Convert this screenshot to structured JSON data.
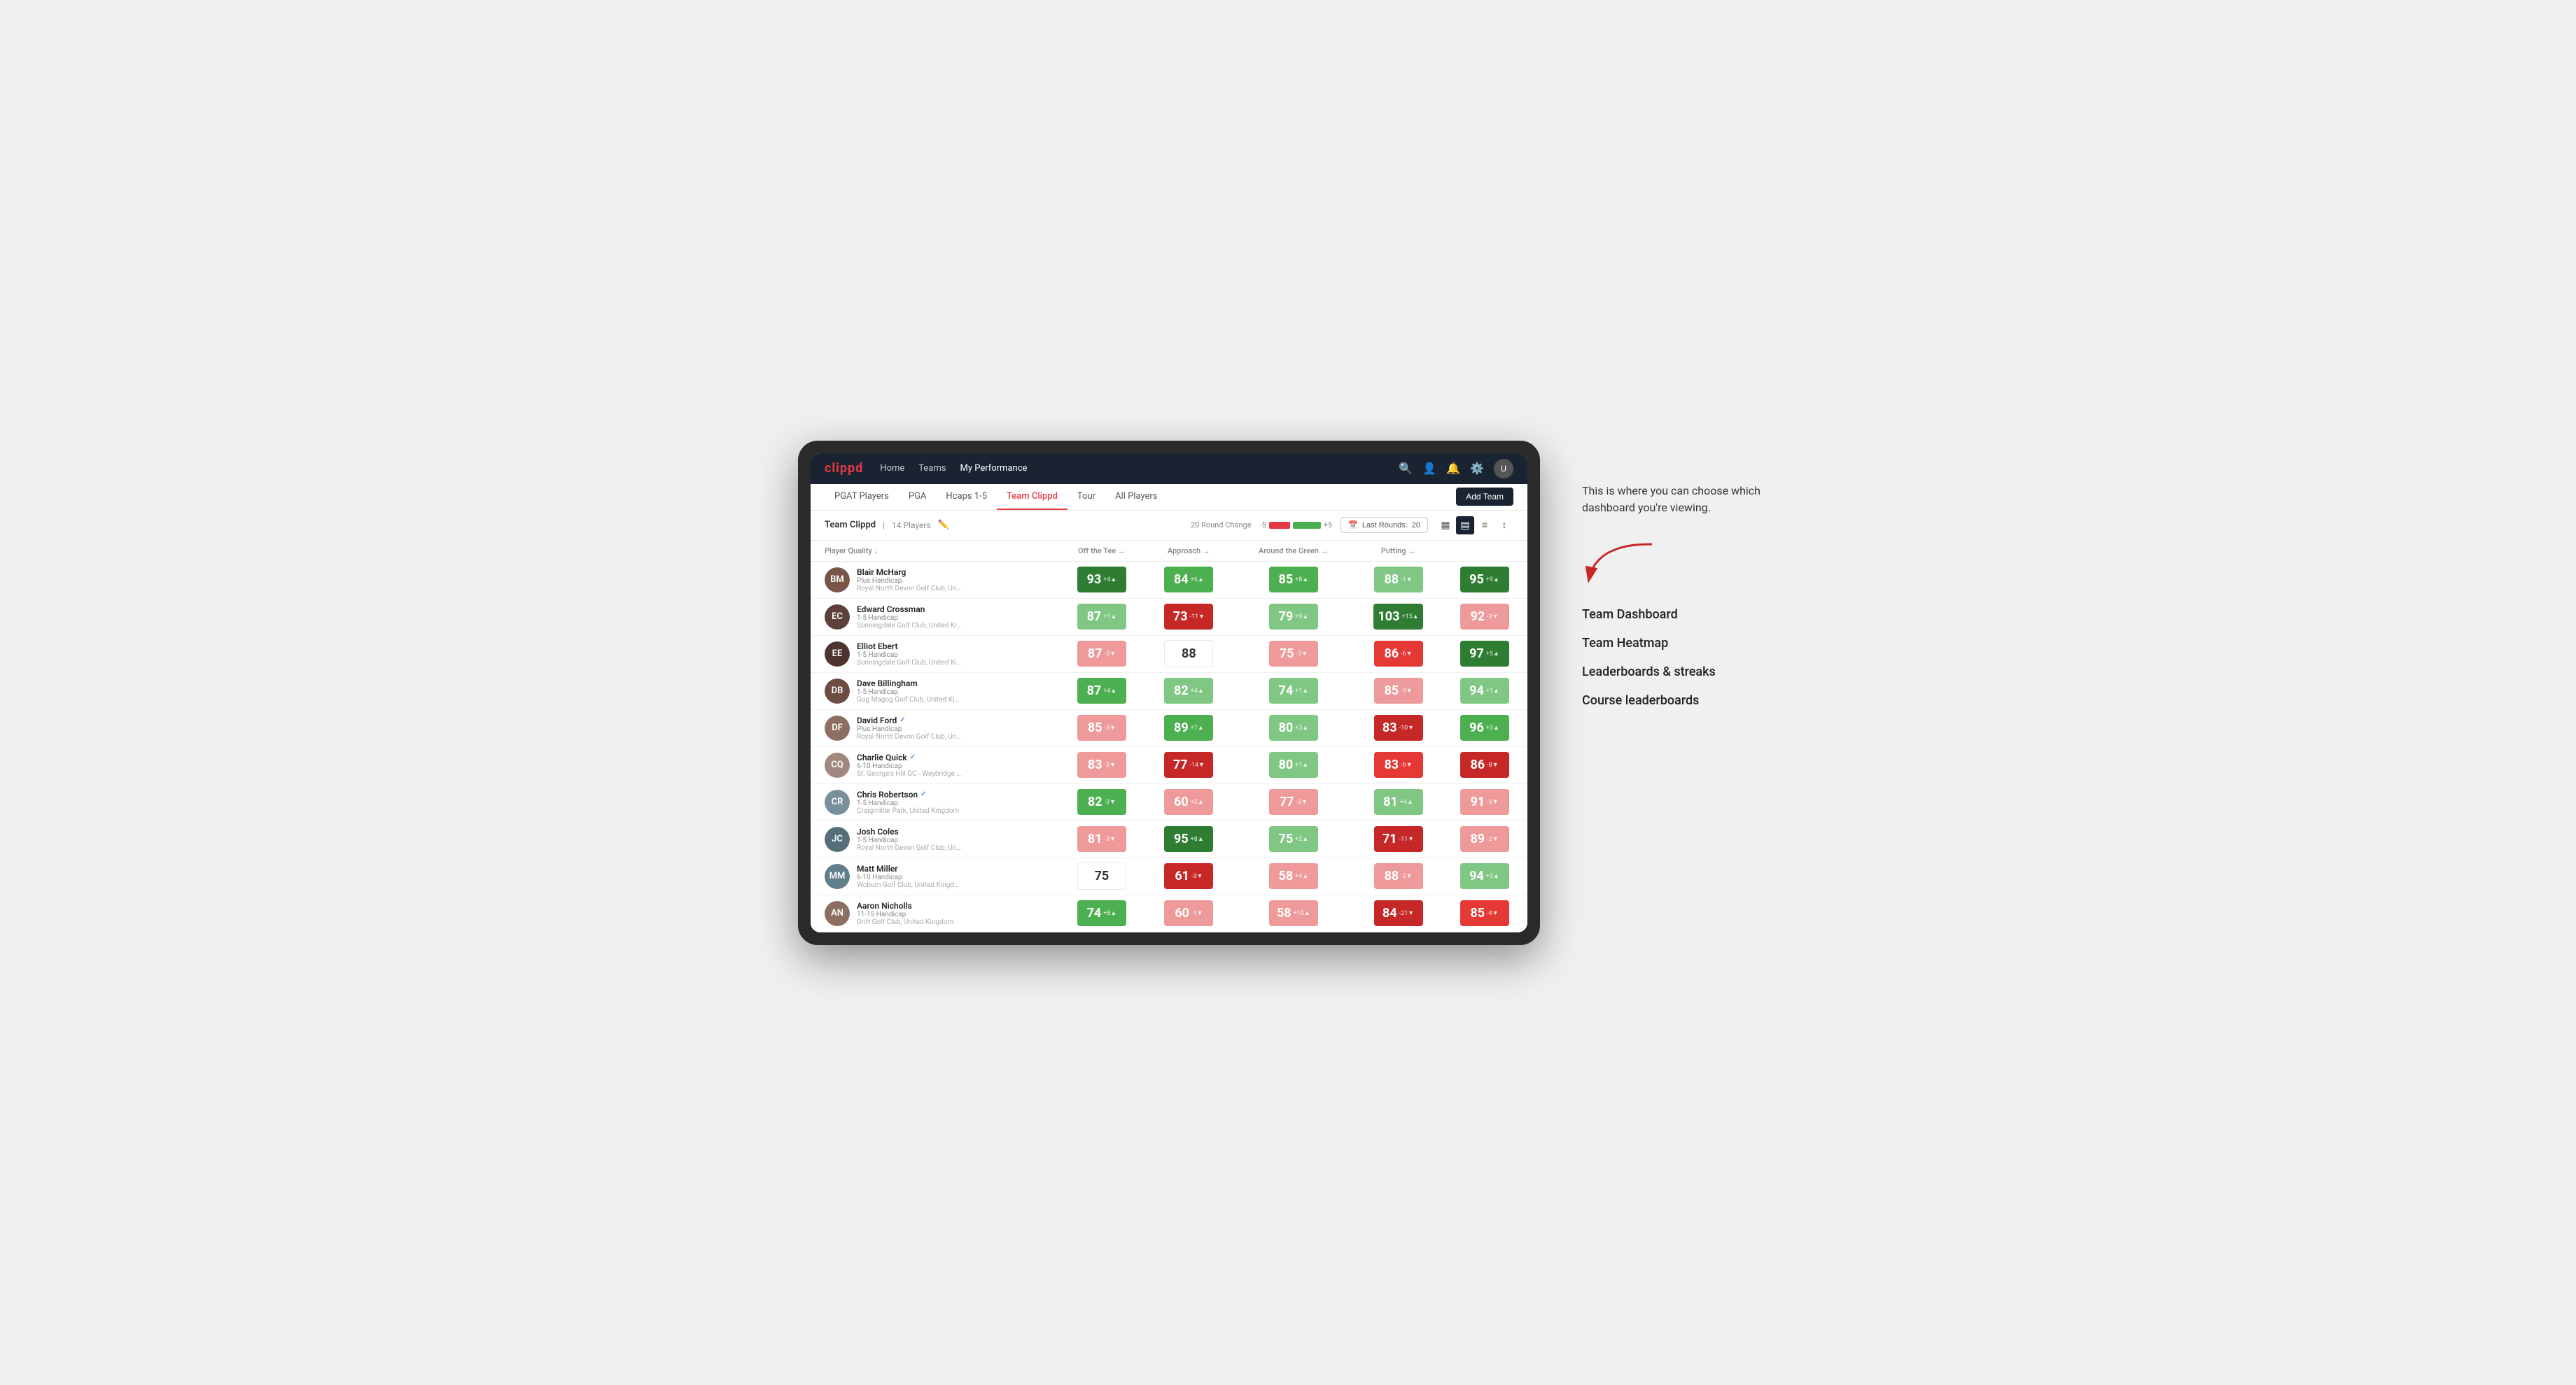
{
  "app": {
    "logo": "clippd",
    "nav_links": [
      {
        "label": "Home",
        "active": false
      },
      {
        "label": "Teams",
        "active": false
      },
      {
        "label": "My Performance",
        "active": true
      }
    ],
    "sub_nav_links": [
      {
        "label": "PGAT Players",
        "active": false
      },
      {
        "label": "PGA",
        "active": false
      },
      {
        "label": "Hcaps 1-5",
        "active": false
      },
      {
        "label": "Team Clippd",
        "active": true
      },
      {
        "label": "Tour",
        "active": false
      },
      {
        "label": "All Players",
        "active": false
      }
    ],
    "add_team_label": "Add Team"
  },
  "team": {
    "name": "Team Clippd",
    "player_count": "14 Players",
    "round_change_label": "20 Round Change",
    "round_change_min": "-5",
    "round_change_max": "+5",
    "last_rounds_label": "Last Rounds:",
    "last_rounds_value": "20"
  },
  "table": {
    "columns": [
      {
        "label": "Player Quality ↓",
        "key": "quality"
      },
      {
        "label": "Off the Tee →",
        "key": "tee"
      },
      {
        "label": "Approach →",
        "key": "approach"
      },
      {
        "label": "Around the Green →",
        "key": "green"
      },
      {
        "label": "Putting →",
        "key": "putting"
      }
    ],
    "players": [
      {
        "name": "Blair McHarg",
        "handicap": "Plus Handicap",
        "club": "Royal North Devon Golf Club, United Kingdom",
        "verified": false,
        "avatar_color": "#795548",
        "initials": "BM",
        "quality": {
          "value": 93,
          "change": "+4",
          "dir": "up",
          "color": "bg-green-dark"
        },
        "tee": {
          "value": 84,
          "change": "+6",
          "dir": "up",
          "color": "bg-green-mid"
        },
        "approach": {
          "value": 85,
          "change": "+8",
          "dir": "up",
          "color": "bg-green-mid"
        },
        "green": {
          "value": 88,
          "change": "-1",
          "dir": "down",
          "color": "bg-green-light"
        },
        "putting": {
          "value": 95,
          "change": "+9",
          "dir": "up",
          "color": "bg-green-dark"
        }
      },
      {
        "name": "Edward Crossman",
        "handicap": "1-5 Handicap",
        "club": "Sunningdale Golf Club, United Kingdom",
        "verified": false,
        "avatar_color": "#5d4037",
        "initials": "EC",
        "quality": {
          "value": 87,
          "change": "+1",
          "dir": "up",
          "color": "bg-green-light"
        },
        "tee": {
          "value": 73,
          "change": "-11",
          "dir": "down",
          "color": "bg-red-dark"
        },
        "approach": {
          "value": 79,
          "change": "+9",
          "dir": "up",
          "color": "bg-green-light"
        },
        "green": {
          "value": 103,
          "change": "+15",
          "dir": "up",
          "color": "bg-green-dark"
        },
        "putting": {
          "value": 92,
          "change": "-3",
          "dir": "down",
          "color": "bg-red-light"
        }
      },
      {
        "name": "Elliot Ebert",
        "handicap": "1-5 Handicap",
        "club": "Sunningdale Golf Club, United Kingdom",
        "verified": false,
        "avatar_color": "#4e342e",
        "initials": "EE",
        "quality": {
          "value": 87,
          "change": "-3",
          "dir": "down",
          "color": "bg-red-light"
        },
        "tee": {
          "value": 88,
          "change": "",
          "dir": "none",
          "color": "bg-white"
        },
        "approach": {
          "value": 75,
          "change": "-3",
          "dir": "down",
          "color": "bg-red-light"
        },
        "green": {
          "value": 86,
          "change": "-6",
          "dir": "down",
          "color": "bg-red-mid"
        },
        "putting": {
          "value": 97,
          "change": "+5",
          "dir": "up",
          "color": "bg-green-dark"
        }
      },
      {
        "name": "Dave Billingham",
        "handicap": "1-5 Handicap",
        "club": "Gog Magog Golf Club, United Kingdom",
        "verified": false,
        "avatar_color": "#6d4c41",
        "initials": "DB",
        "quality": {
          "value": 87,
          "change": "+4",
          "dir": "up",
          "color": "bg-green-mid"
        },
        "tee": {
          "value": 82,
          "change": "+4",
          "dir": "up",
          "color": "bg-green-light"
        },
        "approach": {
          "value": 74,
          "change": "+1",
          "dir": "up",
          "color": "bg-green-light"
        },
        "green": {
          "value": 85,
          "change": "-3",
          "dir": "down",
          "color": "bg-red-light"
        },
        "putting": {
          "value": 94,
          "change": "+1",
          "dir": "up",
          "color": "bg-green-light"
        }
      },
      {
        "name": "David Ford",
        "handicap": "Plus Handicap",
        "club": "Royal North Devon Golf Club, United Kingdom",
        "verified": true,
        "avatar_color": "#8d6e63",
        "initials": "DF",
        "quality": {
          "value": 85,
          "change": "-3",
          "dir": "down",
          "color": "bg-red-light"
        },
        "tee": {
          "value": 89,
          "change": "+7",
          "dir": "up",
          "color": "bg-green-mid"
        },
        "approach": {
          "value": 80,
          "change": "+3",
          "dir": "up",
          "color": "bg-green-light"
        },
        "green": {
          "value": 83,
          "change": "-10",
          "dir": "down",
          "color": "bg-red-dark"
        },
        "putting": {
          "value": 96,
          "change": "+3",
          "dir": "up",
          "color": "bg-green-mid"
        }
      },
      {
        "name": "Charlie Quick",
        "handicap": "6-10 Handicap",
        "club": "St. George's Hill GC - Weybridge - Surrey, Uni...",
        "verified": true,
        "avatar_color": "#a1887f",
        "initials": "CQ",
        "quality": {
          "value": 83,
          "change": "-3",
          "dir": "down",
          "color": "bg-red-light"
        },
        "tee": {
          "value": 77,
          "change": "-14",
          "dir": "down",
          "color": "bg-red-dark"
        },
        "approach": {
          "value": 80,
          "change": "+1",
          "dir": "up",
          "color": "bg-green-light"
        },
        "green": {
          "value": 83,
          "change": "-6",
          "dir": "down",
          "color": "bg-red-mid"
        },
        "putting": {
          "value": 86,
          "change": "-8",
          "dir": "down",
          "color": "bg-red-dark"
        }
      },
      {
        "name": "Chris Robertson",
        "handicap": "1-5 Handicap",
        "club": "Craigmillar Park, United Kingdom",
        "verified": true,
        "avatar_color": "#78909c",
        "initials": "CR",
        "quality": {
          "value": 82,
          "change": "-3",
          "dir": "down",
          "color": "bg-green-mid"
        },
        "tee": {
          "value": 60,
          "change": "+2",
          "dir": "up",
          "color": "bg-red-light"
        },
        "approach": {
          "value": 77,
          "change": "-3",
          "dir": "down",
          "color": "bg-red-light"
        },
        "green": {
          "value": 81,
          "change": "+4",
          "dir": "up",
          "color": "bg-green-light"
        },
        "putting": {
          "value": 91,
          "change": "-3",
          "dir": "down",
          "color": "bg-red-light"
        }
      },
      {
        "name": "Josh Coles",
        "handicap": "1-5 Handicap",
        "club": "Royal North Devon Golf Club, United Kingdom",
        "verified": false,
        "avatar_color": "#546e7a",
        "initials": "JC",
        "quality": {
          "value": 81,
          "change": "-3",
          "dir": "down",
          "color": "bg-red-light"
        },
        "tee": {
          "value": 95,
          "change": "+8",
          "dir": "up",
          "color": "bg-green-dark"
        },
        "approach": {
          "value": 75,
          "change": "+2",
          "dir": "up",
          "color": "bg-green-light"
        },
        "green": {
          "value": 71,
          "change": "-11",
          "dir": "down",
          "color": "bg-red-dark"
        },
        "putting": {
          "value": 89,
          "change": "-2",
          "dir": "down",
          "color": "bg-red-light"
        }
      },
      {
        "name": "Matt Miller",
        "handicap": "6-10 Handicap",
        "club": "Woburn Golf Club, United Kingdom",
        "verified": false,
        "avatar_color": "#607d8b",
        "initials": "MM",
        "quality": {
          "value": 75,
          "change": "",
          "dir": "none",
          "color": "bg-white"
        },
        "tee": {
          "value": 61,
          "change": "-3",
          "dir": "down",
          "color": "bg-red-dark"
        },
        "approach": {
          "value": 58,
          "change": "+4",
          "dir": "up",
          "color": "bg-red-light"
        },
        "green": {
          "value": 88,
          "change": "-2",
          "dir": "down",
          "color": "bg-red-light"
        },
        "putting": {
          "value": 94,
          "change": "+3",
          "dir": "up",
          "color": "bg-green-light"
        }
      },
      {
        "name": "Aaron Nicholls",
        "handicap": "11-15 Handicap",
        "club": "Drift Golf Club, United Kingdom",
        "verified": false,
        "avatar_color": "#8d6e63",
        "initials": "AN",
        "quality": {
          "value": 74,
          "change": "+8",
          "dir": "up",
          "color": "bg-green-mid"
        },
        "tee": {
          "value": 60,
          "change": "-1",
          "dir": "down",
          "color": "bg-red-light"
        },
        "approach": {
          "value": 58,
          "change": "+10",
          "dir": "up",
          "color": "bg-red-light"
        },
        "green": {
          "value": 84,
          "change": "-21",
          "dir": "down",
          "color": "bg-red-dark"
        },
        "putting": {
          "value": 85,
          "change": "-4",
          "dir": "down",
          "color": "bg-red-mid"
        }
      }
    ]
  },
  "annotation": {
    "intro_text": "This is where you can choose which dashboard you're viewing.",
    "items": [
      "Team Dashboard",
      "Team Heatmap",
      "Leaderboards & streaks",
      "Course leaderboards"
    ]
  }
}
